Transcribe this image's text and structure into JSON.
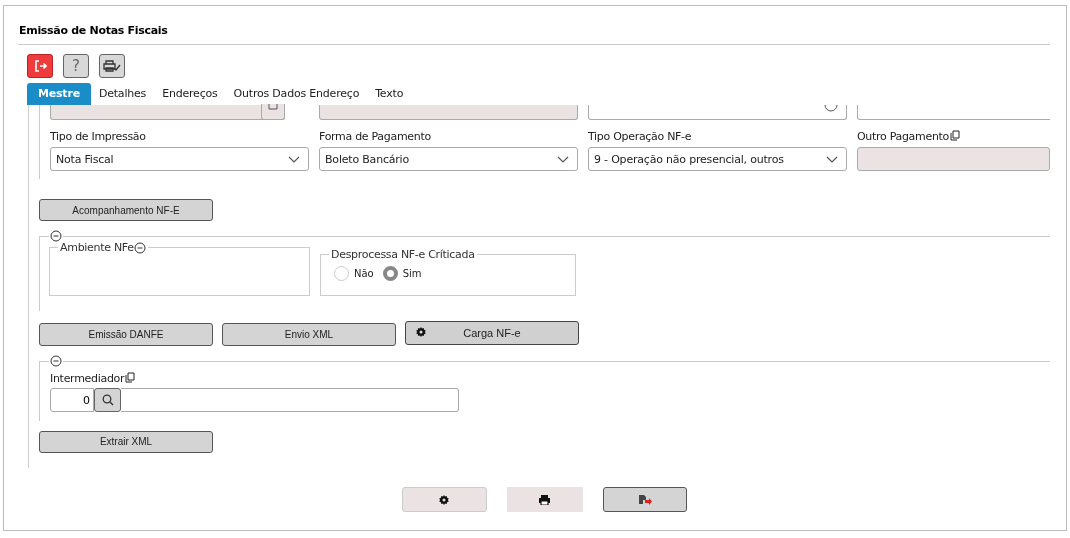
{
  "title": "Emissão de Notas Fiscais",
  "toolbar": [
    {
      "kind": "exit"
    },
    {
      "kind": "help",
      "label": "?"
    },
    {
      "kind": "print-check"
    }
  ],
  "tabs": [
    {
      "label": "Mestre",
      "selected": true
    },
    {
      "label": "Detalhes",
      "selected": false
    },
    {
      "label": "Endereços",
      "selected": false
    },
    {
      "label": "Outros Dados Endereço",
      "selected": false
    },
    {
      "label": "Texto",
      "selected": false
    }
  ],
  "top_row_fields": [
    {
      "kind": "date"
    },
    {
      "kind": "readonly"
    },
    {
      "kind": "time"
    },
    {
      "kind": "text"
    }
  ],
  "fields": [
    {
      "label": "Tipo de Impressão",
      "kind": "select",
      "value": "Nota Fiscal"
    },
    {
      "label": "Forma de Pagamento",
      "kind": "select",
      "value": "Boleto Bancário"
    },
    {
      "label": "Tipo Operação NF-e",
      "kind": "select",
      "value": "9 - Operação não presencial, outros"
    },
    {
      "label": "Outro Pagamento",
      "kind": "readonly",
      "copy": true
    }
  ],
  "acompanhamento_button": "Acompanhamento NF-E",
  "ambiente": {
    "legend": "Ambiente NFe"
  },
  "desprocessa": {
    "legend": "Desprocessa NF-e Críticada",
    "options": [
      {
        "label": "Não",
        "selected": false
      },
      {
        "label": "Sim",
        "selected": true
      }
    ]
  },
  "action_buttons": [
    {
      "label": "Emissão DANFE",
      "kind": "text"
    },
    {
      "label": "Envio XML",
      "kind": "text"
    },
    {
      "label": "Carga NF-e",
      "kind": "icon-text"
    }
  ],
  "intermediador": {
    "label": "Intermediador",
    "code": "0"
  },
  "extrair_button": "Extrair XML",
  "footer_buttons": [
    {
      "kind": "gear"
    },
    {
      "kind": "print"
    },
    {
      "kind": "exit"
    }
  ]
}
